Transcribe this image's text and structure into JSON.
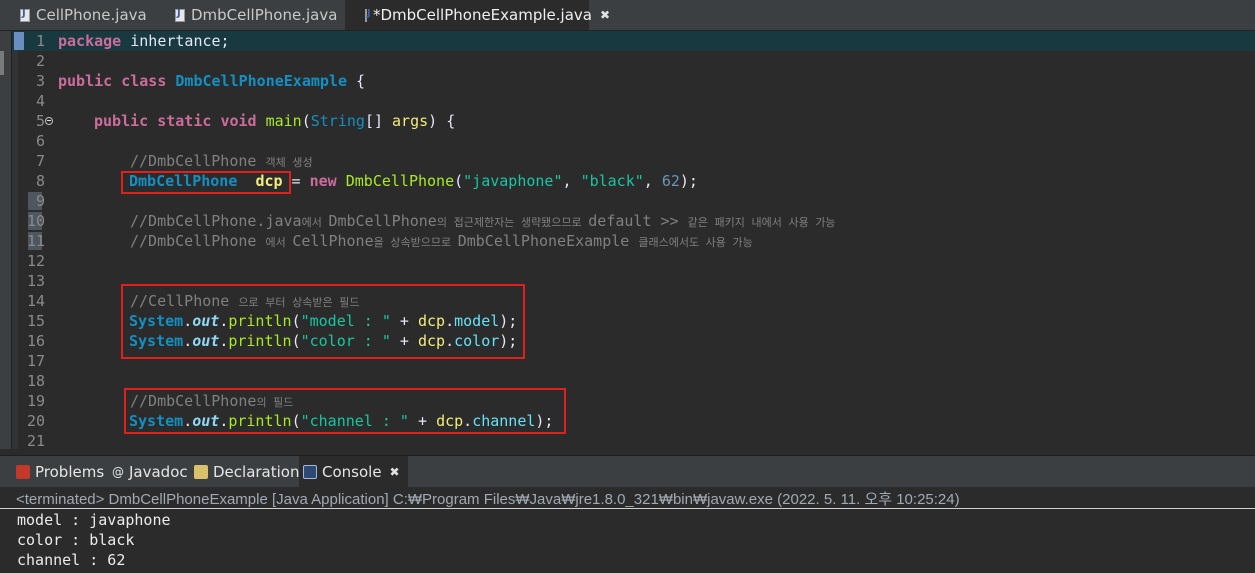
{
  "editor_tabs": [
    {
      "label": "CellPhone.java",
      "active": false
    },
    {
      "label": "DmbCellPhone.java",
      "active": false
    },
    {
      "label": "*DmbCellPhoneExample.java",
      "active": true
    }
  ],
  "code": {
    "l1": {
      "num": "1",
      "kw": "package",
      "rest": " inhertance;"
    },
    "l3": {
      "num": "3",
      "kw1": "public",
      "kw2": "class",
      "cls": "DmbCellPhoneExample",
      "rest": " {"
    },
    "l4": {
      "num": "4"
    },
    "l5": {
      "num": "5",
      "kw1": "public",
      "kw2": "static",
      "kw3": "void",
      "fn": "main",
      "p1": "(",
      "type": "String",
      "p2": "[] ",
      "arg": "args",
      "p3": ") {"
    },
    "l6": {
      "num": "6"
    },
    "l7": {
      "num": "7",
      "cmt": "//DmbCellPhone ",
      "cmt_k": "객체 생성"
    },
    "l8": {
      "num": "8",
      "type": "DmbCellPhone",
      "var": "dcp",
      "eq": " = ",
      "kw": "new",
      "cls": " DmbCellPhone",
      "p1": "(",
      "s1": "\"javaphone\"",
      "c1": ", ",
      "s2": "\"black\"",
      "c2": ", ",
      "n": "62",
      "p2": ");"
    },
    "l9": {
      "num": "9"
    },
    "l10": {
      "num": "10",
      "cmt1": "//DmbCellPhone.java",
      "k1": "에서 ",
      "cmt2": "DmbCellPhone",
      "k2": "의 접근제한자는 생략됐으므로 ",
      "cmt3": "default >> ",
      "k3": "같은 패키지 내에서 사용 가능"
    },
    "l11": {
      "num": "11",
      "cmt1": "//DmbCellPhone ",
      "k1": "에서 ",
      "cmt2": "CellPhone",
      "k2": "을 상속받으므로 ",
      "cmt3": "DmbCellPhoneExample ",
      "k3": "클래스에서도 사용 가능"
    },
    "l12": {
      "num": "12"
    },
    "l13": {
      "num": "13"
    },
    "l14": {
      "num": "14",
      "cmt": "//CellPhone ",
      "cmt_k": "으로 부터 상속받은 필드"
    },
    "l15": {
      "num": "15",
      "cls": "System",
      "dot1": ".",
      "out": "out",
      "dot2": ".",
      "m": "println",
      "p1": "(",
      "s": "\"model : \"",
      "plus": " + ",
      "var": "dcp",
      "dot3": ".",
      "fld": "model",
      "p2": ");"
    },
    "l16": {
      "num": "16",
      "cls": "System",
      "dot1": ".",
      "out": "out",
      "dot2": ".",
      "m": "println",
      "p1": "(",
      "s": "\"color : \"",
      "plus": " + ",
      "var": "dcp",
      "dot3": ".",
      "fld": "color",
      "p2": ");"
    },
    "l17": {
      "num": "17"
    },
    "l18": {
      "num": "18"
    },
    "l19": {
      "num": "19",
      "cmt": "//DmbCellPhone",
      "cmt_k": "의 필드"
    },
    "l20": {
      "num": "20",
      "cls": "System",
      "dot1": ".",
      "out": "out",
      "dot2": ".",
      "m": "println",
      "p1": "(",
      "s": "\"channel : \"",
      "plus": " + ",
      "var": "dcp",
      "dot3": ".",
      "fld": "channel",
      "p2": ");"
    },
    "l21": {
      "num": "21"
    }
  },
  "panel_tabs": [
    {
      "label": "Problems",
      "icon": "problems-icon"
    },
    {
      "label": "Javadoc",
      "icon": "javadoc-icon"
    },
    {
      "label": "Declaration",
      "icon": "declaration-icon"
    },
    {
      "label": "Console",
      "icon": "console-icon",
      "active": true
    }
  ],
  "console": {
    "header": "<terminated> DmbCellPhoneExample [Java Application] C:₩Program Files₩Java₩jre1.8.0_321₩bin₩javaw.exe  (2022. 5. 11. 오후 10:25:24)",
    "lines": [
      "model : javaphone",
      "color : black",
      "channel : 62"
    ]
  },
  "colors": {
    "keyword": "#cc6c9c",
    "class": "#1290c3",
    "string": "#17c6a3",
    "comment": "#808080",
    "highlight_box": "#e0201c"
  }
}
